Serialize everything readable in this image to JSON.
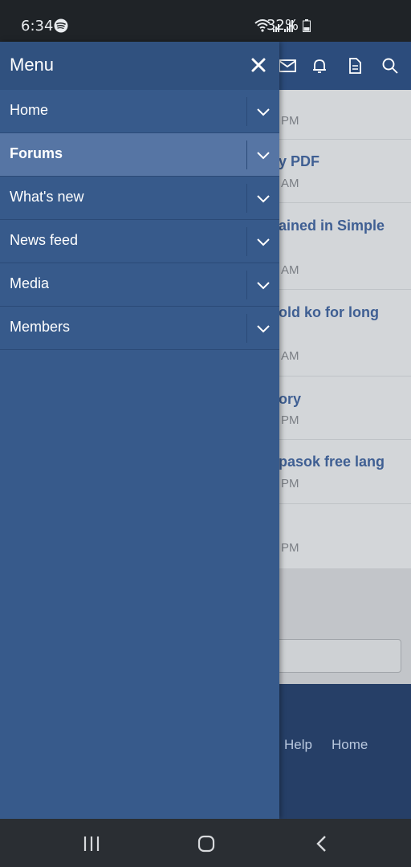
{
  "status_bar": {
    "time": "6:34",
    "battery": "32%",
    "icons": [
      "spotify-icon",
      "wifi-icon",
      "signal-icon",
      "battery-icon"
    ]
  },
  "drawer": {
    "title": "Menu",
    "items": [
      {
        "label": "Home"
      },
      {
        "label": "Forums",
        "active": true
      },
      {
        "label": "What's new"
      },
      {
        "label": "News feed"
      },
      {
        "label": "Media"
      },
      {
        "label": "Members"
      }
    ]
  },
  "topbar": {
    "icons": [
      "mail-icon",
      "bell-icon",
      "document-icon",
      "search-icon"
    ]
  },
  "feed": {
    "items": [
      {
        "title": "",
        "time": "PM"
      },
      {
        "title": "y PDF",
        "time": "AM"
      },
      {
        "title": "ained in Simple",
        "time": "AM"
      },
      {
        "title": "old ko for long",
        "time": "AM"
      },
      {
        "title": "ory",
        "time": "PM"
      },
      {
        "title": "pasok free lang",
        "time": "PM"
      },
      {
        "title": "",
        "time": "PM"
      }
    ]
  },
  "footer": {
    "links": [
      "Help",
      "Home"
    ]
  },
  "navbar": {
    "icons": [
      "recents-icon",
      "home-icon",
      "back-icon"
    ]
  },
  "colors": {
    "drawer": "#375a8b",
    "drawer_active": "#5675a4",
    "feed_title": "#3f5f93",
    "footer": "#263f67"
  }
}
